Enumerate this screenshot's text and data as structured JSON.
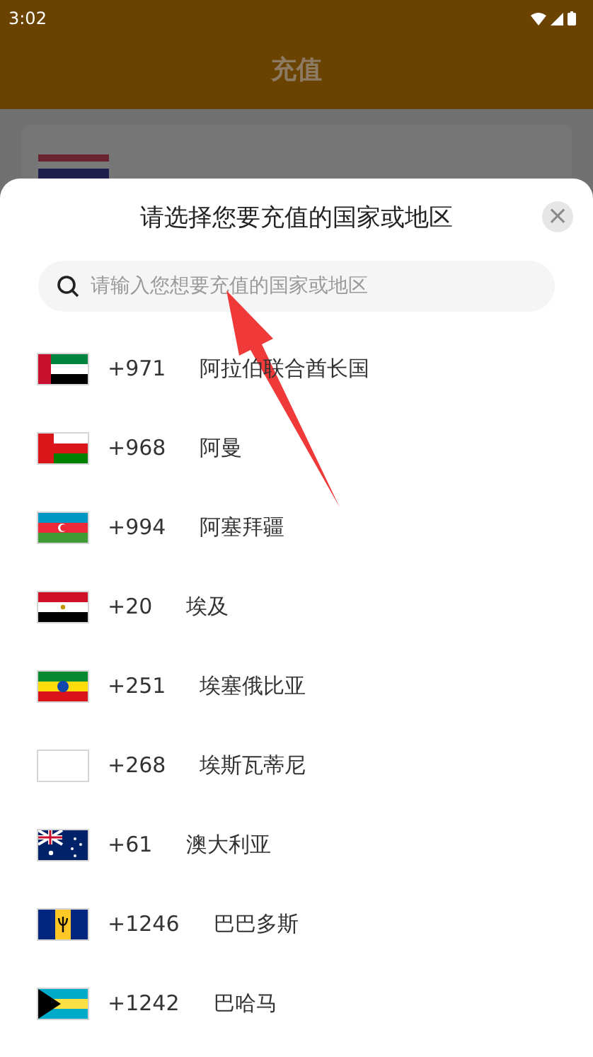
{
  "status_bar": {
    "time": "3:02"
  },
  "header": {
    "title": "充值"
  },
  "sheet": {
    "title": "请选择您要充值的国家或地区",
    "close": "×",
    "search": {
      "placeholder": "请输入您想要充值的国家或地区"
    },
    "countries": [
      {
        "code": "+971",
        "name": "阿拉伯联合酋长国"
      },
      {
        "code": "+968",
        "name": "阿曼"
      },
      {
        "code": "+994",
        "name": "阿塞拜疆"
      },
      {
        "code": "+20",
        "name": "埃及"
      },
      {
        "code": "+251",
        "name": "埃塞俄比亚"
      },
      {
        "code": "+268",
        "name": "埃斯瓦蒂尼"
      },
      {
        "code": "+61",
        "name": "澳大利亚"
      },
      {
        "code": "+1246",
        "name": "巴巴多斯"
      },
      {
        "code": "+1242",
        "name": "巴哈马"
      }
    ]
  }
}
